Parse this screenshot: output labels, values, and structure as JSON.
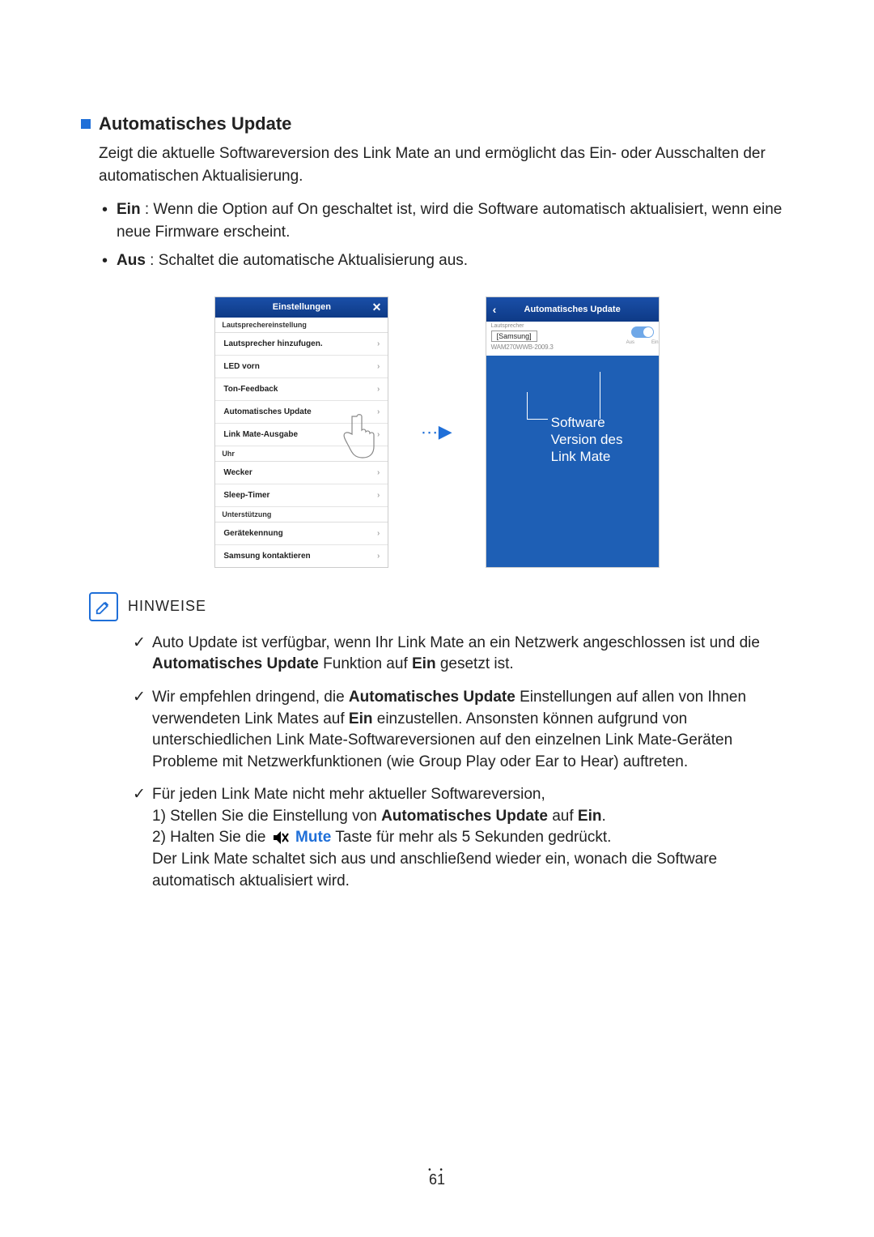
{
  "heading": "Automatisches Update",
  "intro": "Zeigt die aktuelle Softwareversion des Link Mate an und ermöglicht das Ein- oder Ausschalten der automatischen Aktualisierung.",
  "bullets": [
    {
      "label": "Ein",
      "text": " : Wenn die Option auf On geschaltet ist, wird die Software automatisch aktualisiert, wenn eine neue Firmware erscheint."
    },
    {
      "label": "Aus",
      "text": " : Schaltet die automatische Aktualisierung aus."
    }
  ],
  "phone_left": {
    "title": "Einstellungen",
    "close": "✕",
    "sections": {
      "speaker": "Lautsprechereinstellung",
      "clock": "Uhr",
      "support": "Unterstützung"
    },
    "rows": {
      "add_speaker": "Lautsprecher hinzufugen.",
      "led": "LED vorn",
      "tone": "Ton-Feedback",
      "auto_update": "Automatisches Update",
      "output": "Link Mate-Ausgabe",
      "alarm": "Wecker",
      "sleep": "Sleep-Timer",
      "device_id": "Gerätekennung",
      "contact": "Samsung kontaktieren"
    }
  },
  "arrow": "∙∙∙▶",
  "phone_right": {
    "title": "Automatisches Update",
    "back": "‹",
    "speaker_label": "Lautsprecher",
    "speaker_name": "[Samsung]",
    "model": "WAM270WWB-2009.3",
    "toggle_off": "Aus",
    "toggle_on": "Ein",
    "annotation_l1": "Software",
    "annotation_l2": "Version des",
    "annotation_l3": "Link Mate"
  },
  "notes_title": "HINWEISE",
  "notes": {
    "n1_a": "Auto Update ist verfügbar, wenn Ihr Link Mate an ein Netzwerk angeschlossen ist und die ",
    "n1_b": "Automatisches Update",
    "n1_c": " Funktion auf ",
    "n1_d": "Ein",
    "n1_e": " gesetzt ist.",
    "n2_a": "Wir empfehlen dringend, die ",
    "n2_b": "Automatisches Update",
    "n2_c": " Einstellungen auf allen von Ihnen verwendeten Link Mates auf ",
    "n2_d": "Ein",
    "n2_e": " einzustellen. Ansonsten können aufgrund von unterschiedlichen Link Mate-Softwareversionen auf den einzelnen Link Mate-Geräten Probleme mit Netzwerkfunktionen (wie Group Play oder Ear to Hear) auftreten.",
    "n3_lead": "Für jeden Link Mate nicht mehr aktueller Softwareversion,",
    "n3_1a": "1) Stellen Sie die Einstellung von ",
    "n3_1b": "Automatisches Update",
    "n3_1c": " auf ",
    "n3_1d": "Ein",
    "n3_1e": ".",
    "n3_2a": "2) Halten Sie die ",
    "n3_2b": "Mute",
    "n3_2c": " Taste für mehr als 5 Sekunden gedrückt.",
    "n3_tail": "Der Link Mate schaltet sich aus und anschließend wieder ein, wonach die Software automatisch aktualisiert wird."
  },
  "page_number": "61",
  "page_dots": "• •"
}
